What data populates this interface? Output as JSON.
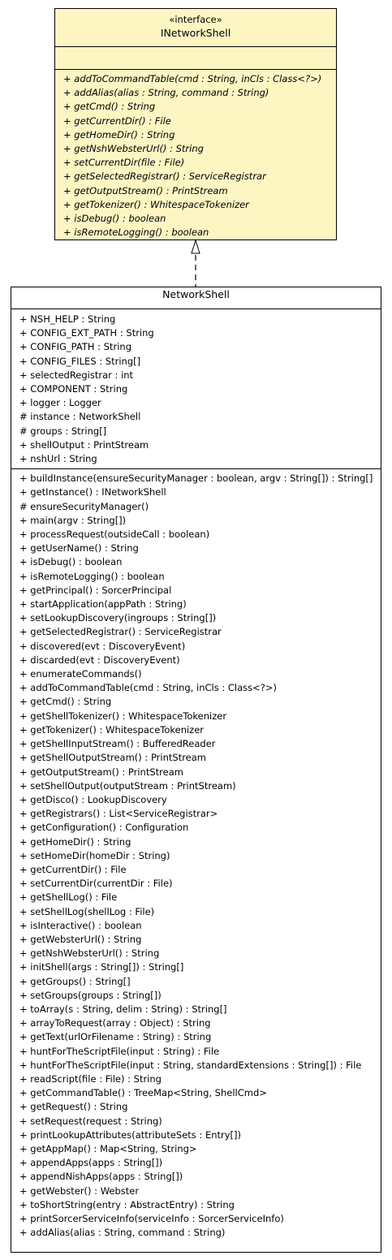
{
  "interface": {
    "stereotype": "«interface»",
    "name": "INetworkShell",
    "operations": [
      "+ addToCommandTable(cmd : String, inCls : Class<?>)",
      "+ addAlias(alias : String, command : String)",
      "+ getCmd() : String",
      "+ getCurrentDir() : File",
      "+ getHomeDir() : String",
      "+ getNshWebsterUrl() : String",
      "+ setCurrentDir(file : File)",
      "+ getSelectedRegistrar() : ServiceRegistrar",
      "+ getOutputStream() : PrintStream",
      "+ getTokenizer() : WhitespaceTokenizer",
      "+ isDebug() : boolean",
      "+ isRemoteLogging() : boolean"
    ]
  },
  "class": {
    "name": "NetworkShell",
    "attributes": [
      "+ NSH_HELP : String",
      "+ CONFIG_EXT_PATH : String",
      "+ CONFIG_PATH : String",
      "+ CONFIG_FILES : String[]",
      "+ selectedRegistrar : int",
      "+ COMPONENT : String",
      "+ logger : Logger",
      "# instance : NetworkShell",
      "# groups : String[]",
      "+ shellOutput : PrintStream",
      "+ nshUrl : String"
    ],
    "operations": [
      "+ buildInstance(ensureSecurityManager : boolean, argv : String[]) : String[]",
      "+ getInstance() : INetworkShell",
      "# ensureSecurityManager()",
      "+ main(argv : String[])",
      "+ processRequest(outsideCall : boolean)",
      "+ getUserName() : String",
      "+ isDebug() : boolean",
      "+ isRemoteLogging() : boolean",
      "+ getPrincipal() : SorcerPrincipal",
      "+ startApplication(appPath : String)",
      "+ setLookupDiscovery(ingroups : String[])",
      "+ getSelectedRegistrar() : ServiceRegistrar",
      "+ discovered(evt : DiscoveryEvent)",
      "+ discarded(evt : DiscoveryEvent)",
      "+ enumerateCommands()",
      "+ addToCommandTable(cmd : String, inCls : Class<?>)",
      "+ getCmd() : String",
      "+ getShellTokenizer() : WhitespaceTokenizer",
      "+ getTokenizer() : WhitespaceTokenizer",
      "+ getShellInputStream() : BufferedReader",
      "+ getShellOutputStream() : PrintStream",
      "+ getOutputStream() : PrintStream",
      "+ setShellOutput(outputStream : PrintStream)",
      "+ getDisco() : LookupDiscovery",
      "+ getRegistrars() : List<ServiceRegistrar>",
      "+ getConfiguration() : Configuration",
      "+ getHomeDir() : String",
      "+ setHomeDir(homeDir : String)",
      "+ getCurrentDir() : File",
      "+ setCurrentDir(currentDir : File)",
      "+ getShellLog() : File",
      "+ setShellLog(shellLog : File)",
      "+ isInteractive() : boolean",
      "+ getWebsterUrl() : String",
      "+ getNshWebsterUrl() : String",
      "+ initShell(args : String[]) : String[]",
      "+ getGroups() : String[]",
      "+ setGroups(groups : String[])",
      "+ toArray(s : String, delim : String) : String[]",
      "+ arrayToRequest(array : Object) : String",
      "+ getText(urlOrFilename : String) : String",
      "+ huntForTheScriptFile(input : String) : File",
      "+ huntForTheScriptFile(input : String, standardExtensions : String[]) : File",
      "+ readScript(file : File) : String",
      "+ getCommandTable() : TreeMap<String, ShellCmd>",
      "+ getRequest() : String",
      "+ setRequest(request : String)",
      "+ printLookupAttributes(attributeSets : Entry[])",
      "+ getAppMap() : Map<String, String>",
      "+ appendApps(apps : String[])",
      "+ appendNishApps(apps : String[])",
      "+ getWebster() : Webster",
      "+ toShortString(entry : AbstractEntry) : String",
      "+ printSorcerServiceInfo(serviceInfo : SorcerServiceInfo)",
      "+ addAlias(alias : String, command : String)"
    ]
  },
  "relationship": {
    "type": "realization"
  },
  "colors": {
    "interface_fill": "#fdf6c3",
    "class_fill": "#ffffff",
    "line": "#000000"
  }
}
